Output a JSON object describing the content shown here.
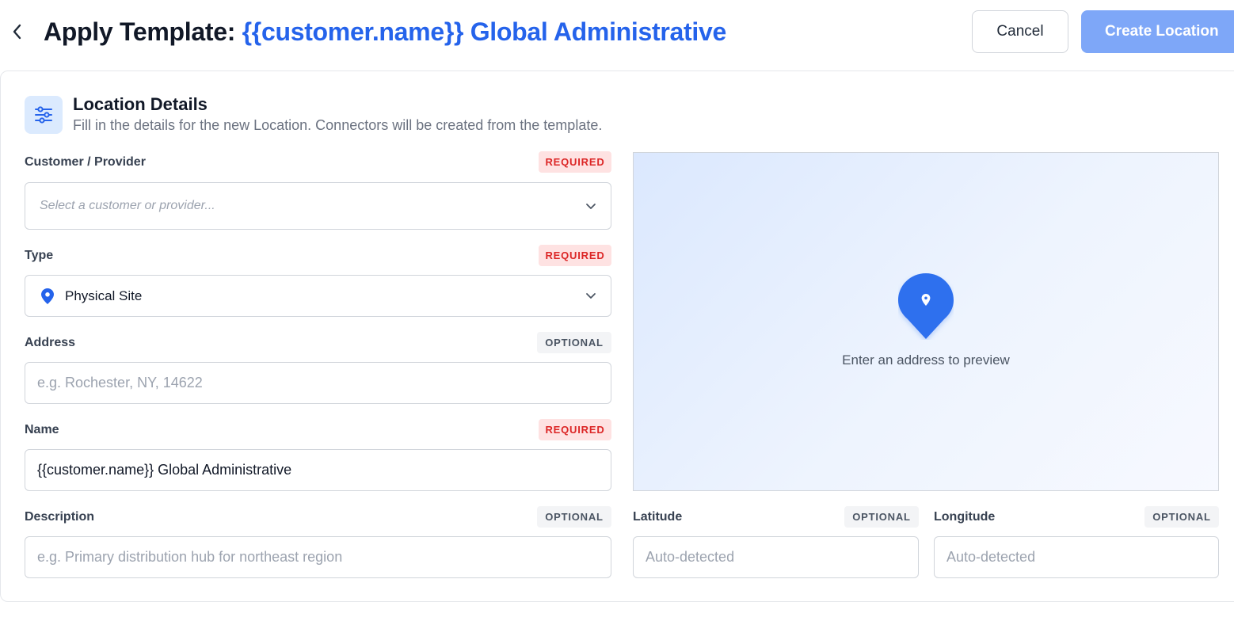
{
  "header": {
    "title_prefix": "Apply Template: ",
    "title_template": "{{customer.name}} Global Administrative",
    "cancel_label": "Cancel",
    "create_label": "Create Location"
  },
  "section": {
    "icon": "sliders-icon",
    "title": "Location Details",
    "subtitle": "Fill in the details for the new Location. Connectors will be created from the template."
  },
  "fields": {
    "customer": {
      "label": "Customer / Provider",
      "badge": "REQUIRED",
      "placeholder": "Select a customer or provider..."
    },
    "type": {
      "label": "Type",
      "badge": "REQUIRED",
      "value": "Physical Site",
      "icon": "map-pin-icon"
    },
    "address": {
      "label": "Address",
      "badge": "OPTIONAL",
      "placeholder": "e.g. Rochester, NY, 14622"
    },
    "name": {
      "label": "Name",
      "badge": "REQUIRED",
      "value": "{{customer.name}} Global Administrative"
    },
    "description": {
      "label": "Description",
      "badge": "OPTIONAL",
      "placeholder": "e.g. Primary distribution hub for northeast region"
    },
    "latitude": {
      "label": "Latitude",
      "badge": "OPTIONAL",
      "placeholder": "Auto-detected"
    },
    "longitude": {
      "label": "Longitude",
      "badge": "OPTIONAL",
      "placeholder": "Auto-detected"
    }
  },
  "map": {
    "hint": "Enter an address to preview"
  },
  "colors": {
    "accent": "#2563eb",
    "required": "#dc2626",
    "create_button": "#7ea7f8"
  }
}
